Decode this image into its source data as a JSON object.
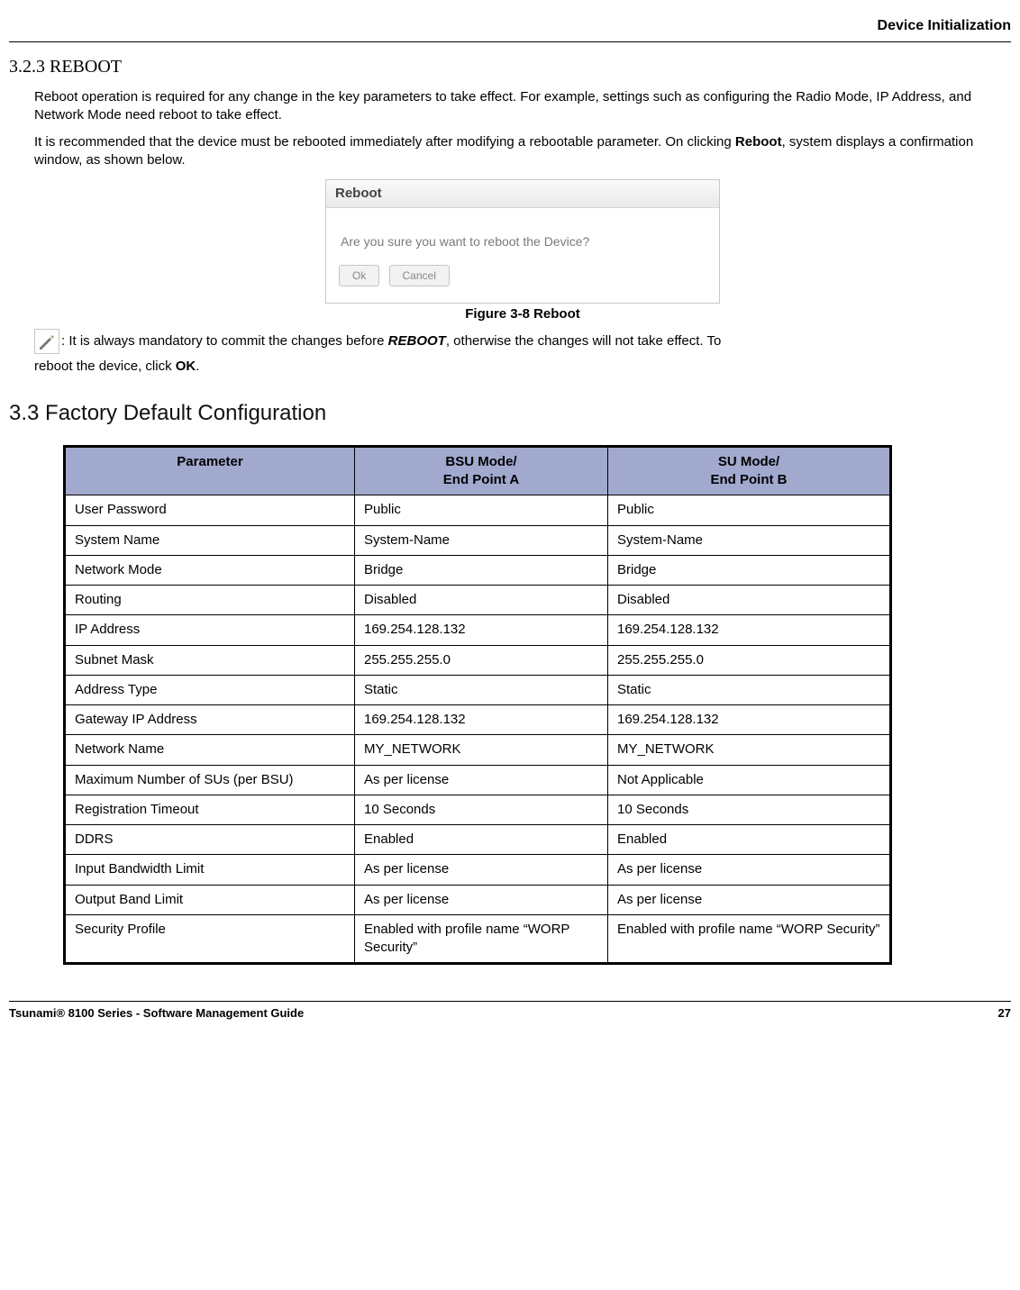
{
  "header": {
    "title": "Device Initialization"
  },
  "section": {
    "num_title": "3.2.3 REBOOT",
    "para1a": "Reboot operation is required for any change in the key parameters to take effect. For example, settings such as configuring the Radio Mode, IP Address, and Network Mode need reboot to take effect.",
    "para2a": "It is recommended that the device must be rebooted immediately after modifying a rebootable parameter. On clicking ",
    "reboot_bold": "Reboot",
    "para2b": ", system displays a confirmation window, as shown below."
  },
  "dialog": {
    "title": "Reboot",
    "message": "Are you sure you want to reboot the Device?",
    "ok": "Ok",
    "cancel": "Cancel"
  },
  "figure_caption": "Figure 3-8 Reboot",
  "note": {
    "lead": ": It is always mandatory to commit the changes before ",
    "reboot_bi": "REBOOT",
    "mid": ", otherwise the changes will not take effect. To",
    "line2a": "reboot the device, click ",
    "ok_bold": "OK",
    "line2b": "."
  },
  "section33": "3.3 Factory Default Configuration",
  "table": {
    "headers": {
      "col1": "Parameter",
      "col2a": "BSU Mode/",
      "col2b": "End Point A",
      "col3a": "SU Mode/",
      "col3b": "End Point B"
    },
    "rows": [
      {
        "p": "User Password",
        "a": "Public",
        "b": "Public"
      },
      {
        "p": "System Name",
        "a": "System-Name",
        "b": "System-Name"
      },
      {
        "p": "Network Mode",
        "a": "Bridge",
        "b": "Bridge"
      },
      {
        "p": "Routing",
        "a": "Disabled",
        "b": "Disabled"
      },
      {
        "p": "IP Address",
        "a": "169.254.128.132",
        "b": "169.254.128.132"
      },
      {
        "p": "Subnet Mask",
        "a": "255.255.255.0",
        "b": "255.255.255.0"
      },
      {
        "p": "Address Type",
        "a": "Static",
        "b": "Static"
      },
      {
        "p": "Gateway IP Address",
        "a": "169.254.128.132",
        "b": "169.254.128.132"
      },
      {
        "p": "Network Name",
        "a": "MY_NETWORK",
        "b": "MY_NETWORK"
      },
      {
        "p": "Maximum Number of SUs (per BSU)",
        "a": "As per license",
        "b": "Not Applicable"
      },
      {
        "p": "Registration Timeout",
        "a": "10 Seconds",
        "b": "10 Seconds"
      },
      {
        "p": "DDRS",
        "a": "Enabled",
        "b": "Enabled"
      },
      {
        "p": "Input Bandwidth Limit",
        "a": "As per license",
        "b": "As per license"
      },
      {
        "p": "Output Band Limit",
        "a": "As per license",
        "b": "As per license"
      },
      {
        "p": "Security Profile",
        "a": "Enabled with profile name “WORP Security”",
        "b": "Enabled with profile name “WORP Security”"
      }
    ]
  },
  "footer": {
    "left": "Tsunami® 8100 Series - Software Management Guide",
    "right": "27"
  }
}
